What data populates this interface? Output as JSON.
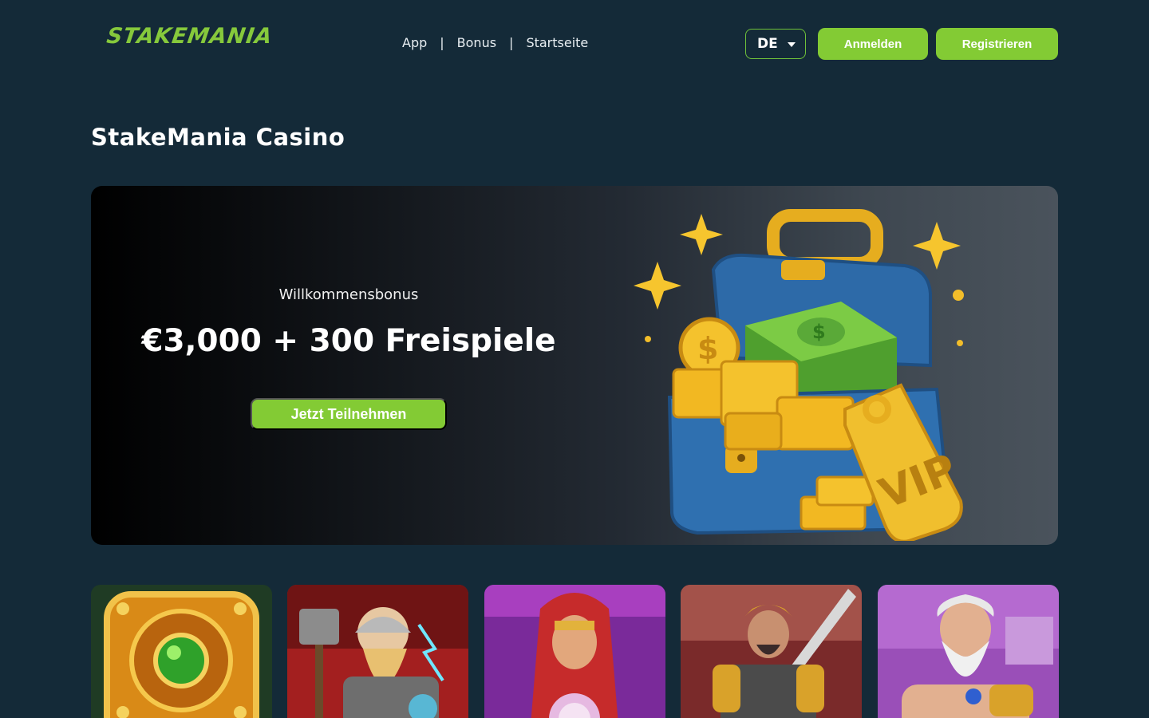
{
  "header": {
    "logo_text": "STAKEMANIA",
    "nav": [
      {
        "label": "App"
      },
      {
        "label": "Bonus"
      },
      {
        "label": "Startseite"
      }
    ],
    "nav_separator": "|",
    "language": "DE",
    "login_label": "Anmelden",
    "register_label": "Registrieren"
  },
  "page_title": "StakeMania Casino",
  "hero": {
    "subtitle": "Willkommensbonus",
    "headline": "€3,000 + 300 Freispiele",
    "cta_label": "Jetzt Teilnehmen",
    "image_tag": "VIP"
  },
  "games": [
    {
      "icon": "green-gem-slot"
    },
    {
      "icon": "viking-thunder-slot"
    },
    {
      "icon": "fortune-teller-slot"
    },
    {
      "icon": "warrior-sword-slot"
    },
    {
      "icon": "zeus-olympus-slot"
    }
  ],
  "colors": {
    "background": "#142a38",
    "accent_green": "#83cb34",
    "logo_green": "#86c93c"
  }
}
